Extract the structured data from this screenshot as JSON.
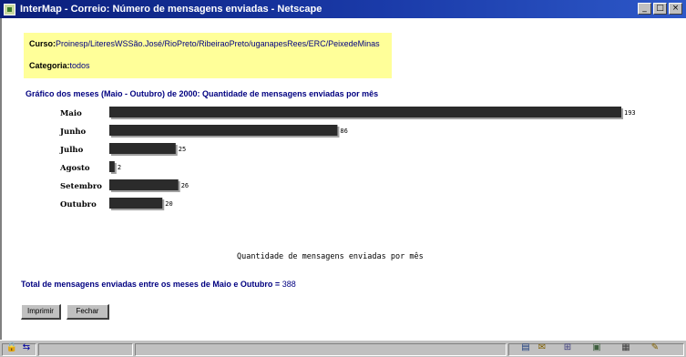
{
  "window": {
    "title": "InterMap - Correio: Número de mensagens enviadas - Netscape",
    "buttons": [
      "_",
      "□",
      "×"
    ]
  },
  "info": {
    "curso_label": "Curso:",
    "curso_value": "Proinesp/LiteresWSSão.José/RioPreto/RibeiraoPreto/uganapesRees/ERC/PeixedeMinas",
    "categoria_label": "Categoria:",
    "categoria_value": "todos"
  },
  "chart_heading": "Gráfico dos meses (Maio - Outubro) de 2000: Quantidade de mensagens enviadas por mês",
  "chart_data": {
    "type": "bar",
    "orientation": "horizontal",
    "categories": [
      "Maio",
      "Junho",
      "Julho",
      "Agosto",
      "Setembro",
      "Outubro"
    ],
    "values": [
      193,
      86,
      25,
      2,
      26,
      20
    ],
    "value_labels": [
      "193",
      "86",
      "25",
      "2",
      "26",
      "20"
    ],
    "xlabel": "Quantidade de mensagens enviadas por mês",
    "xlim": [
      0,
      193
    ],
    "grid": false,
    "colors": {
      "bar": "#2b2b2b",
      "shadow": "#a0a0a0"
    }
  },
  "total": {
    "text": "Total de mensagens enviadas entre os meses de Maio e Outubro = ",
    "value": "388"
  },
  "buttons": {
    "print_label": "Imprimir",
    "close_label": "Fechar"
  },
  "colors": {
    "title_bar": "#0a1e7a",
    "info_box": "#ffff99",
    "heading_text": "#000080"
  },
  "status_icons": [
    "security-icon",
    "connection-icon",
    "navigator-icon",
    "mail-icon",
    "discussion-icon",
    "composer-icon",
    "edit-icon"
  ]
}
